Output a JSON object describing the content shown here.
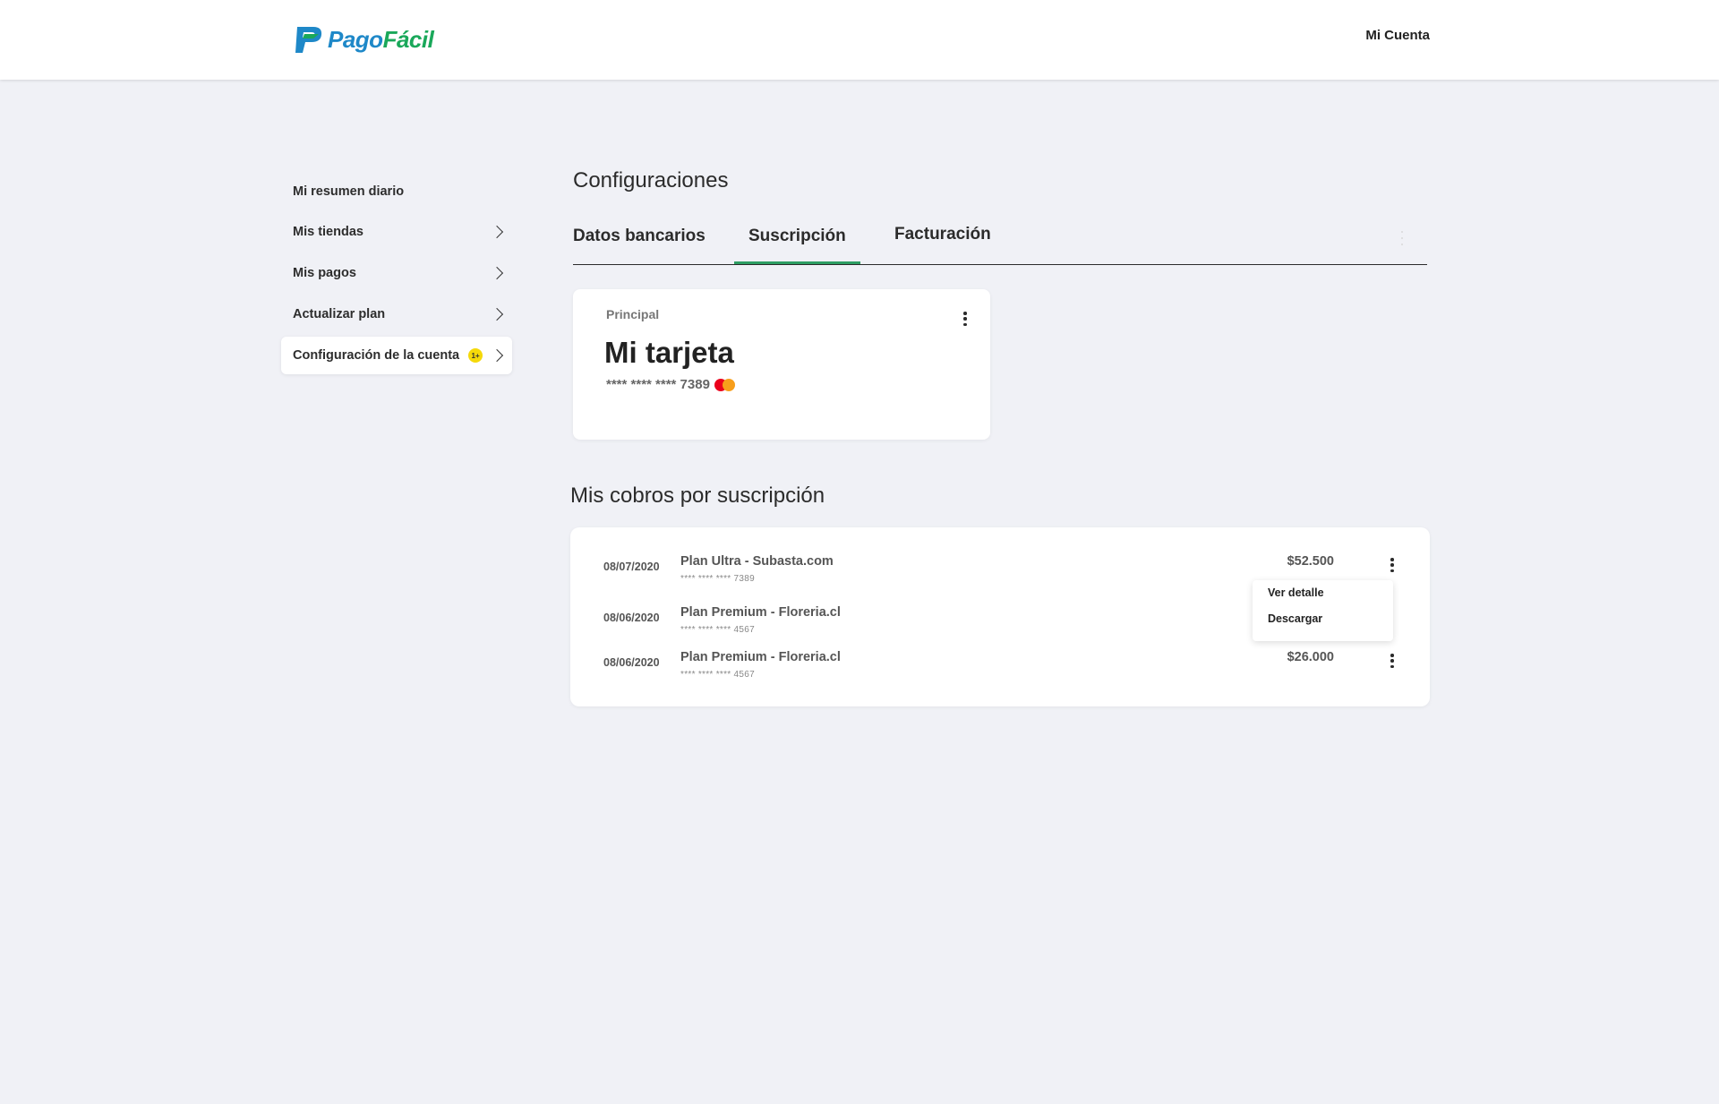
{
  "header": {
    "logo": {
      "part1": "Pago",
      "part2": "Fácil"
    },
    "account_label": "Mi Cuenta"
  },
  "sidebar": {
    "items": [
      {
        "label": "Mi resumen diario",
        "chevron": false
      },
      {
        "label": "Mis tiendas",
        "chevron": true
      },
      {
        "label": "Mis pagos",
        "chevron": true
      },
      {
        "label": "Actualizar plan",
        "chevron": true
      },
      {
        "label": "Configuración de la cuenta",
        "chevron": true,
        "active": true,
        "badge": "1+"
      }
    ]
  },
  "main": {
    "title": "Configuraciones",
    "tabs": [
      {
        "label": "Datos bancarios"
      },
      {
        "label": "Suscripción",
        "active": true
      },
      {
        "label": "Facturación"
      }
    ],
    "card": {
      "label": "Principal",
      "title": "Mi tarjeta",
      "number": "**** **** **** 7389",
      "brand_icon": "mastercard-icon"
    },
    "charges": {
      "title": "Mis cobros por suscripción",
      "rows": [
        {
          "date": "08/07/2020",
          "name": "Plan Ultra - Subasta.com",
          "card": "**** **** **** 7389",
          "amount": "$52.500"
        },
        {
          "date": "08/06/2020",
          "name": "Plan Premium - Floreria.cl",
          "card": "**** **** **** 4567",
          "amount": ""
        },
        {
          "date": "08/06/2020",
          "name": "Plan Premium - Floreria.cl",
          "card": "**** **** **** 4567",
          "amount": "$26.000"
        }
      ],
      "menu": {
        "items": [
          "Ver detalle",
          "Descargar"
        ]
      }
    }
  },
  "colors": {
    "accent_green": "#2e9e63",
    "logo_blue": "#1e88c8",
    "logo_green": "#1aa85a",
    "badge_yellow": "#f5d90a",
    "background": "#f0f1f6"
  }
}
